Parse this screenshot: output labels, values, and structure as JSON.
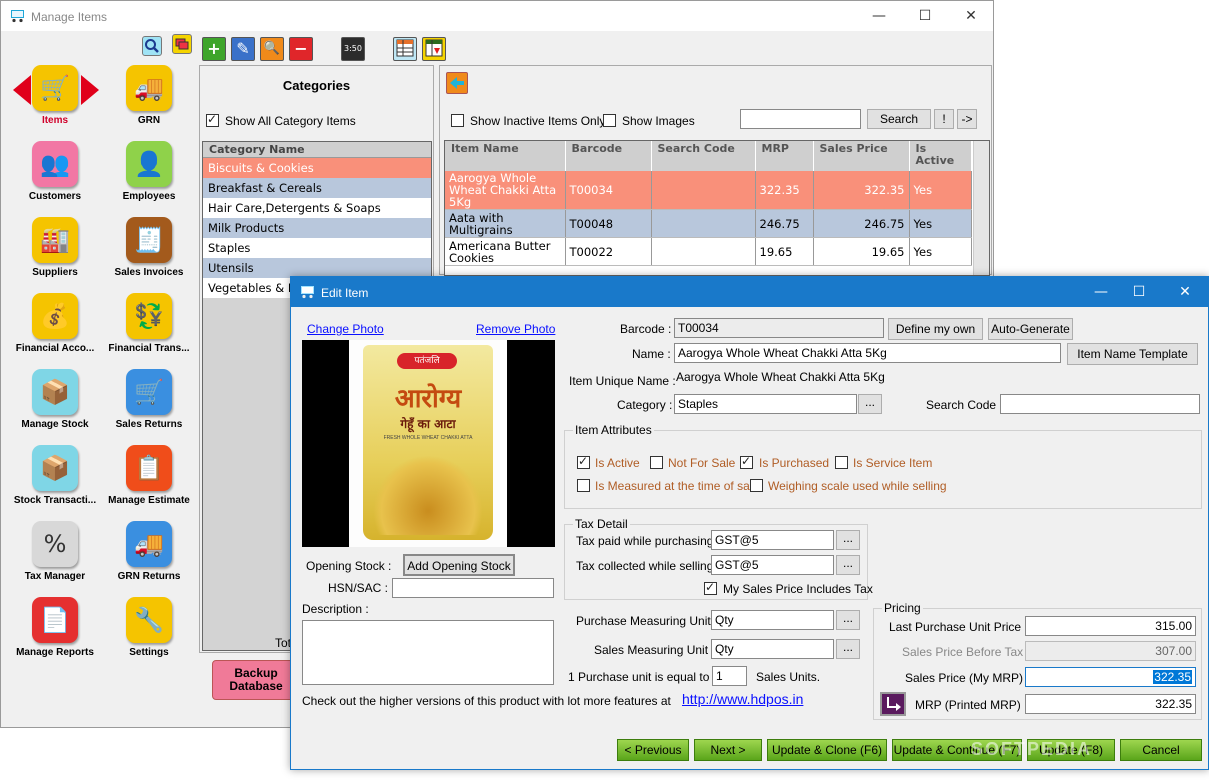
{
  "main_window": {
    "title": "Manage Items",
    "min_label": "—",
    "max_label": "☐",
    "close_label": "✕"
  },
  "nav": {
    "items": [
      {
        "label": "Items",
        "icon": "shopping-cart-icon",
        "glyph": "🛒",
        "color": "#f5c400",
        "active": true
      },
      {
        "label": "GRN",
        "icon": "truck-icon",
        "glyph": "🚚",
        "color": "#f5c400",
        "active": false
      },
      {
        "label": "Customers",
        "icon": "customers-icon",
        "glyph": "👥",
        "color": "#f277a4",
        "active": false
      },
      {
        "label": "Employees",
        "icon": "employee-icon",
        "glyph": "👤",
        "color": "#8fd24a",
        "active": false
      },
      {
        "label": "Suppliers",
        "icon": "factory-icon",
        "glyph": "🏭",
        "color": "#f5c400",
        "active": false
      },
      {
        "label": "Sales Invoices",
        "icon": "invoice-icon",
        "glyph": "🧾",
        "color": "#a35a1c",
        "active": false
      },
      {
        "label": "Financial Acco...",
        "icon": "coins-icon",
        "glyph": "💰",
        "color": "#f5c400",
        "active": false
      },
      {
        "label": "Financial Trans...",
        "icon": "coin-transfer-icon",
        "glyph": "💱",
        "color": "#f5c400",
        "active": false
      },
      {
        "label": "Manage Stock",
        "icon": "stock-trolley-icon",
        "glyph": "📦",
        "color": "#7fd6e6",
        "active": false
      },
      {
        "label": "Sales Returns",
        "icon": "cart-return-icon",
        "glyph": "🛒",
        "color": "#3a8fe0",
        "active": false
      },
      {
        "label": "Stock Transacti...",
        "icon": "stock-transaction-icon",
        "glyph": "📦",
        "color": "#7fd6e6",
        "active": false
      },
      {
        "label": "Manage Estimate",
        "icon": "estimate-icon",
        "glyph": "📋",
        "color": "#f04d1a",
        "active": false
      },
      {
        "label": "Tax Manager",
        "icon": "percent-icon",
        "glyph": "%",
        "color": "#d8d8d8",
        "active": false
      },
      {
        "label": "GRN Returns",
        "icon": "truck-return-icon",
        "glyph": "🚚",
        "color": "#3a8fe0",
        "active": false
      },
      {
        "label": "Manage Reports",
        "icon": "report-icon",
        "glyph": "📄",
        "color": "#e53030",
        "active": false
      },
      {
        "label": "Settings",
        "icon": "tools-icon",
        "glyph": "🔧",
        "color": "#f5c400",
        "active": false
      }
    ]
  },
  "toolbar": {
    "clock_label": "3:50"
  },
  "categories": {
    "title": "Categories",
    "show_all_label": "Show All Category Items",
    "column_header": "Category Name",
    "rows": [
      {
        "name": "Biscuits & Cookies",
        "style": "sel"
      },
      {
        "name": "Breakfast & Cereals",
        "style": "alt"
      },
      {
        "name": "Hair Care,Detergents & Soaps",
        "style": "wht"
      },
      {
        "name": "Milk Products",
        "style": "alt"
      },
      {
        "name": "Staples",
        "style": "wht"
      },
      {
        "name": "Utensils",
        "style": "alt"
      },
      {
        "name": "Vegetables & Fruits",
        "style": "wht"
      }
    ],
    "total_label": "Tot",
    "backup_label": "Backup Database"
  },
  "items": {
    "show_inactive_label": "Show Inactive Items Only",
    "show_images_label": "Show Images",
    "search_value": "",
    "search_button": "Search",
    "excl_button": "!",
    "arrow_button": "->",
    "headers": [
      "Item Name",
      "Barcode",
      "Search Code",
      "MRP",
      "Sales Price",
      "Is Active"
    ],
    "rows": [
      {
        "name": "Aarogya Whole Wheat Chakki Atta 5Kg",
        "barcode": "T00034",
        "search_code": "",
        "mrp": "322.35",
        "price": "322.35",
        "active": "Yes",
        "style": "sel"
      },
      {
        "name": "Aata with Multigrains",
        "barcode": "T00048",
        "search_code": "",
        "mrp": "246.75",
        "price": "246.75",
        "active": "Yes",
        "style": "alt"
      },
      {
        "name": "Americana Butter Cookies",
        "barcode": "T00022",
        "search_code": "",
        "mrp": "19.65",
        "price": "19.65",
        "active": "Yes",
        "style": ""
      }
    ]
  },
  "edit_dialog": {
    "title": "Edit Item",
    "change_photo": "Change Photo",
    "remove_photo": "Remove Photo",
    "photo_brand": "पतंजलि",
    "photo_name": "आरोग्य",
    "photo_sub": "गेहूँ का आटा",
    "photo_caption": "FRESH WHOLE WHEAT CHAKKI ATTA",
    "opening_stock_label": "Opening Stock :",
    "add_opening_stock": "Add Opening Stock",
    "hsn_label": "HSN/SAC :",
    "hsn_value": "",
    "description_label": "Description :",
    "description_value": "",
    "promo_text": "Check out the higher versions of this product with lot more features at",
    "promo_link": "http://www.hdpos.in",
    "barcode_label": "Barcode :",
    "barcode_value": "T00034",
    "define_my_own": "Define my own",
    "auto_generate": "Auto-Generate",
    "name_label": "Name :",
    "name_value": "Aarogya Whole Wheat Chakki Atta 5Kg",
    "name_template": "Item Name Template",
    "unique_name_label": "Item Unique Name :",
    "unique_name_value": "Aarogya Whole Wheat Chakki Atta 5Kg",
    "category_label": "Category :",
    "category_value": "Staples",
    "search_code_label": "Search Code :",
    "search_code_value": "",
    "attributes_title": "Item Attributes",
    "attr_active": "Is Active",
    "attr_not_for_sale": "Not For Sale",
    "attr_purchased": "Is Purchased",
    "attr_service": "Is Service Item",
    "attr_measured": "Is Measured at the time of sale",
    "attr_weighing": "Weighing scale used while selling",
    "tax_title": "Tax Detail",
    "tax_paid_label": "Tax paid while purchasing :",
    "tax_paid_value": "GST@5",
    "tax_collected_label": "Tax collected while selling :",
    "tax_collected_value": "GST@5",
    "includes_tax_label": "My Sales Price Includes Tax",
    "purchase_unit_label": "Purchase Measuring Unit :",
    "purchase_unit_value": "Qty",
    "sales_unit_label": "Sales Measuring Unit :",
    "sales_unit_value": "Qty",
    "unit_ratio_prefix": "1  Purchase unit is equal to :",
    "unit_ratio_value": "1",
    "unit_ratio_suffix": "Sales Units.",
    "pricing_title": "Pricing",
    "last_purchase_label": "Last Purchase  Unit Price :",
    "last_purchase_value": "315.00",
    "before_tax_label": "Sales Price Before Tax :",
    "before_tax_value": "307.00",
    "sales_price_label": "Sales Price (My MRP) :",
    "sales_price_value": "322.35",
    "mrp_label": "MRP (Printed MRP) :",
    "mrp_value": "322.35",
    "ellipsis": "...",
    "btn_previous": "< Previous",
    "btn_next": "Next  >",
    "btn_update_clone": "Update & Clone  (F6)",
    "btn_update_continue": "Update & Continue  (F7)",
    "btn_update": "Update (F8)",
    "btn_cancel": "Cancel",
    "watermark": "SOFTPEDIA"
  }
}
